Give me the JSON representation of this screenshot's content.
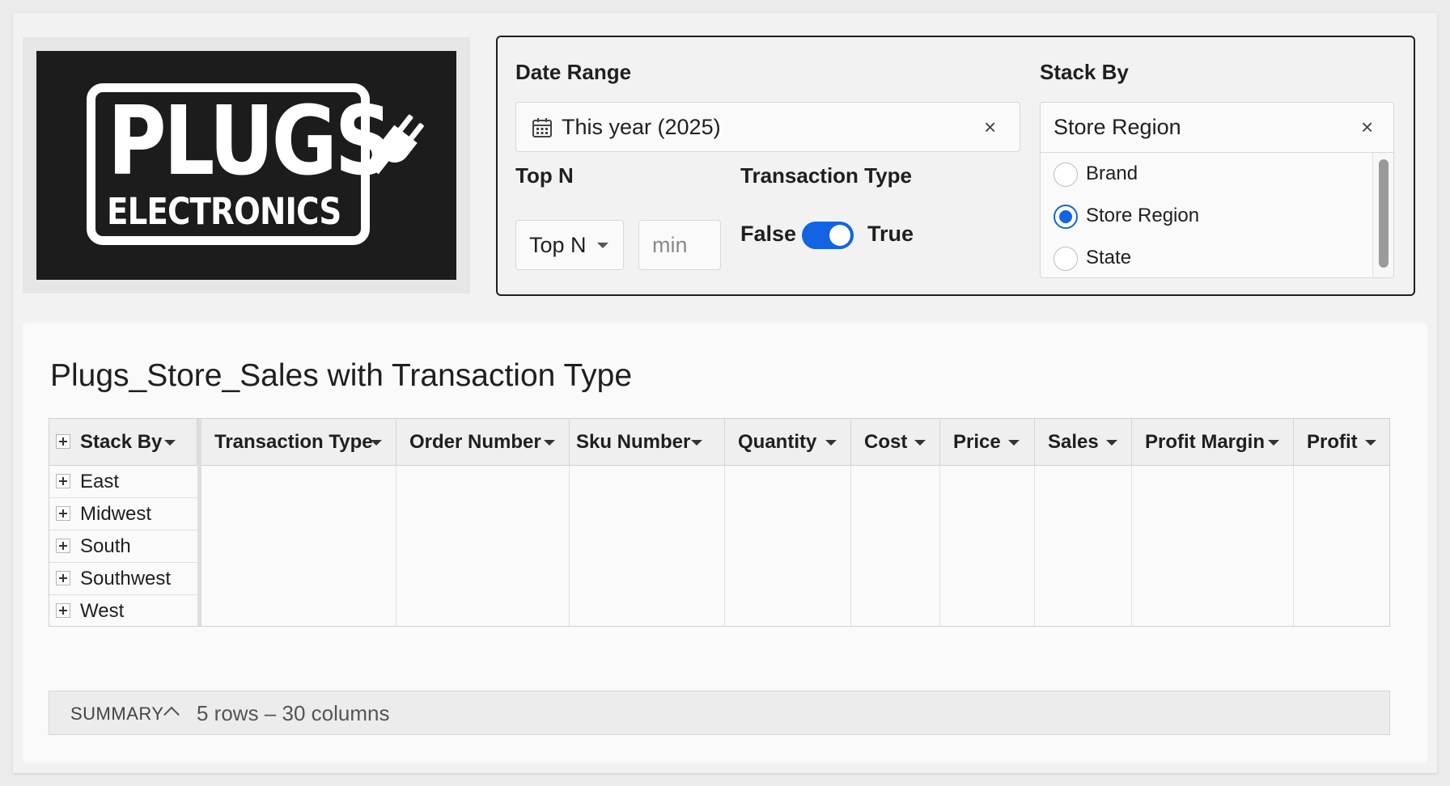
{
  "logo": {
    "line1": "PLUGS",
    "line2": "ELECTRONICS"
  },
  "controls": {
    "date_range": {
      "label": "Date Range",
      "value": "This year (2025)"
    },
    "top_n": {
      "label": "Top N",
      "selected": "Top N",
      "min_placeholder": "min"
    },
    "transaction_type": {
      "label": "Transaction Type",
      "false_label": "False",
      "true_label": "True",
      "value": true
    },
    "stack_by": {
      "label": "Stack By",
      "value": "Store Region",
      "options": [
        {
          "label": "Brand",
          "selected": false
        },
        {
          "label": "Store Region",
          "selected": true
        },
        {
          "label": "State",
          "selected": false
        }
      ]
    },
    "accent_color": "#1264e3"
  },
  "table": {
    "title": "Plugs_Store_Sales with Transaction Type",
    "columns": [
      "Stack By",
      "Transaction Type",
      "Order Number",
      "Sku Number",
      "Quantity",
      "Cost",
      "Price",
      "Sales",
      "Profit Margin",
      "Profit"
    ],
    "rows": [
      "East",
      "Midwest",
      "South",
      "Southwest",
      "West"
    ]
  },
  "summary": {
    "label": "SUMMARY",
    "info": "5 rows – 30 columns"
  }
}
